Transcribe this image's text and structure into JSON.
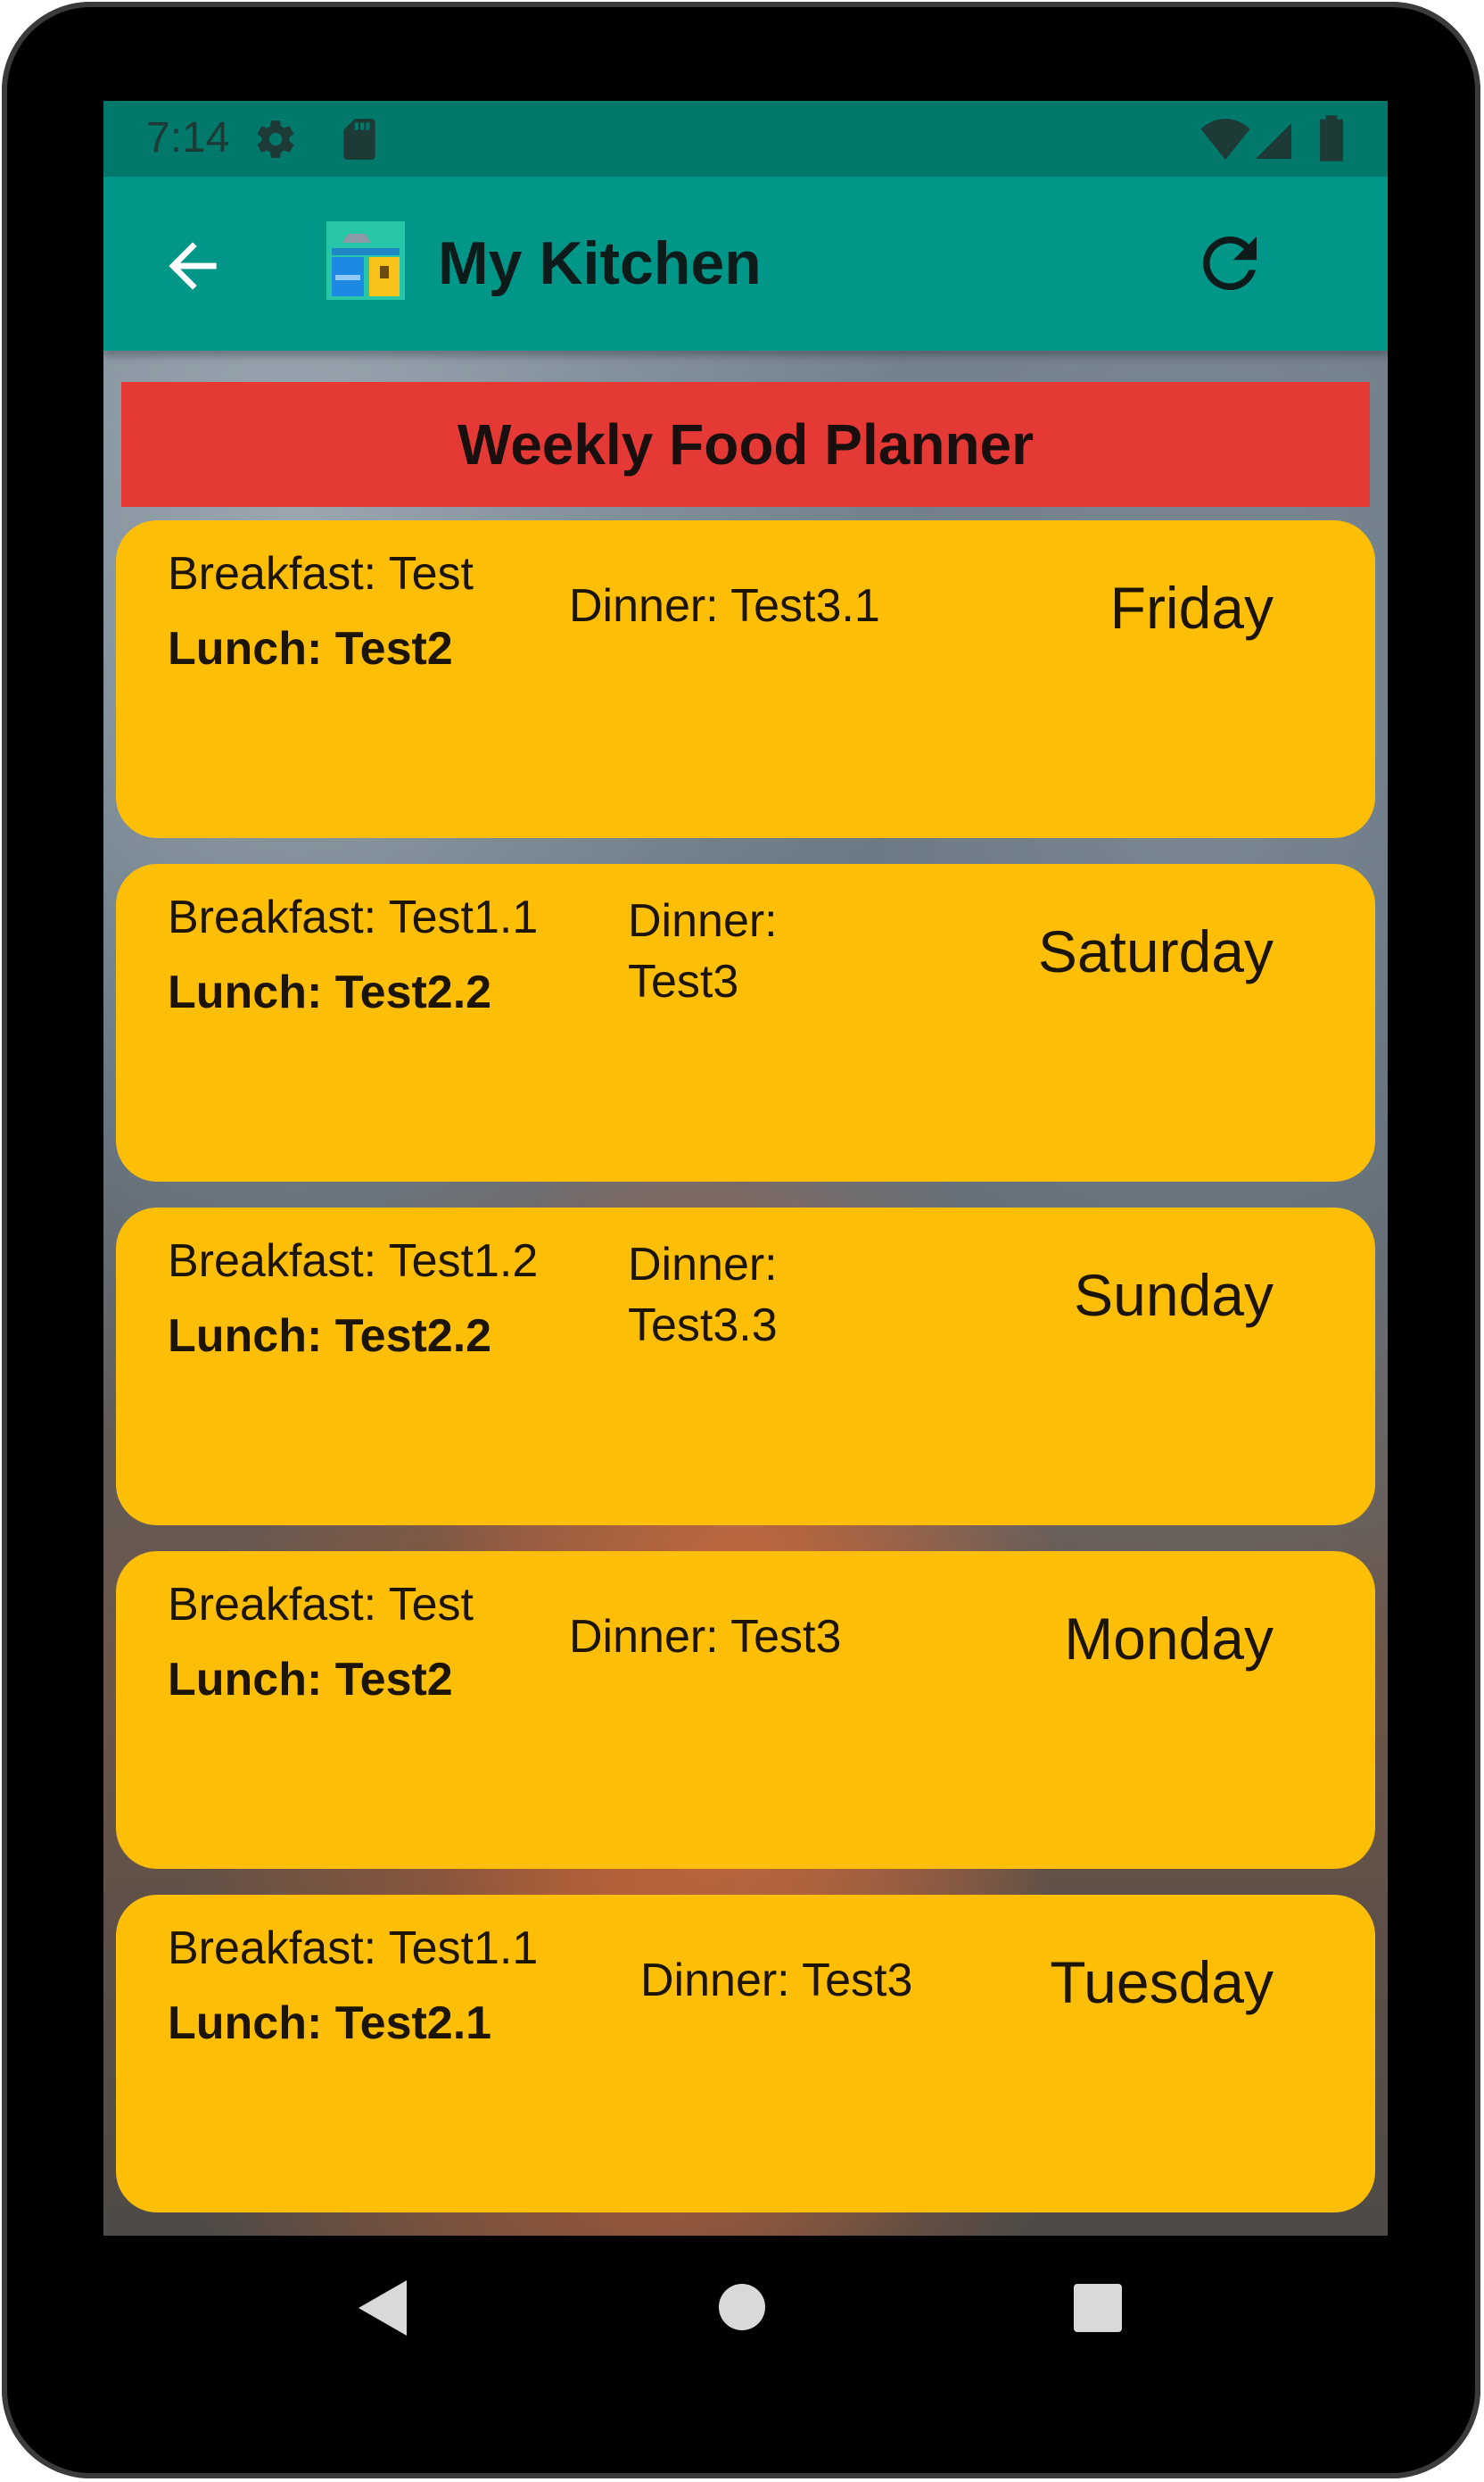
{
  "status_bar": {
    "time": "7:14",
    "icons": [
      "settings-icon",
      "sd-card-icon",
      "wifi-icon",
      "signal-icon",
      "battery-icon"
    ]
  },
  "app_bar": {
    "title": "My Kitchen",
    "back_icon": "arrow-left-icon",
    "refresh_icon": "refresh-icon",
    "color": "#009688"
  },
  "banner": {
    "title": "Weekly Food Planner",
    "color": "#e53935"
  },
  "days": [
    {
      "breakfast": "Breakfast: Test",
      "lunch": "Lunch: Test2",
      "dinner_l1": "Dinner: Test3.1",
      "dinner_l2": "",
      "day": "Friday"
    },
    {
      "breakfast": "Breakfast: Test1.1",
      "lunch": "Lunch: Test2.2",
      "dinner_l1": "Dinner:",
      "dinner_l2": "Test3",
      "day": "Saturday"
    },
    {
      "breakfast": "Breakfast: Test1.2",
      "lunch": "Lunch: Test2.2",
      "dinner_l1": "Dinner:",
      "dinner_l2": "Test3.3",
      "day": "Sunday"
    },
    {
      "breakfast": "Breakfast: Test",
      "lunch": "Lunch: Test2",
      "dinner_l1": "Dinner: Test3",
      "dinner_l2": "",
      "day": "Monday"
    },
    {
      "breakfast": "Breakfast: Test1.1",
      "lunch": "Lunch: Test2.1",
      "dinner_l1": "Dinner: Test3",
      "dinner_l2": "",
      "day": "Tuesday"
    }
  ],
  "card_color": "#fdbe07",
  "nav_bar": {
    "icons": [
      "back-triangle-icon",
      "home-circle-icon",
      "recents-square-icon"
    ]
  }
}
